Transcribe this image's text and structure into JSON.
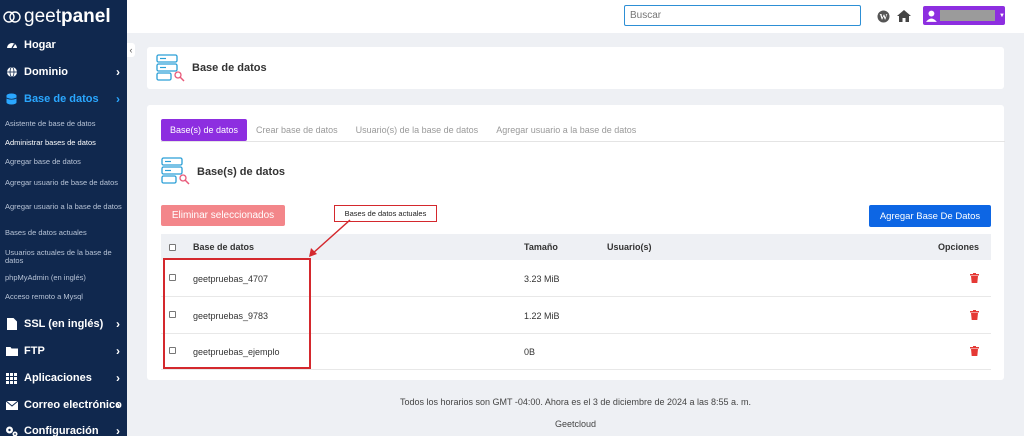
{
  "brand": {
    "prefix": "geet",
    "suffix": "panel"
  },
  "sidebar": {
    "items": [
      {
        "label": "Hogar",
        "icon": "dashboard-icon"
      },
      {
        "label": "Dominio",
        "icon": "globe-icon"
      },
      {
        "label": "Base de datos",
        "icon": "database-icon"
      },
      {
        "label": "SSL (en inglés)",
        "icon": "file-icon"
      },
      {
        "label": "FTP",
        "icon": "folder-icon"
      },
      {
        "label": "Aplicaciones",
        "icon": "grid-icon"
      },
      {
        "label": "Correo electrónico",
        "icon": "envelope-icon"
      },
      {
        "label": "Configuración",
        "icon": "gears-icon"
      }
    ],
    "subitems": [
      "Asistente de base de datos",
      "Administrar bases de datos",
      "Agregar base de datos",
      "Agregar usuario de base de datos",
      "Agregar usuario a la base de datos",
      "Bases de datos actuales",
      "Usuarios actuales de la base de datos",
      "phpMyAdmin (en inglés)",
      "Acceso remoto a Mysql"
    ]
  },
  "topbar": {
    "search_placeholder": "Buscar"
  },
  "header": {
    "title": "Base de datos"
  },
  "tabs": [
    "Base(s) de datos",
    "Crear base de datos",
    "Usuario(s) de la base de datos",
    "Agregar usuario a la base de datos"
  ],
  "section": {
    "title": "Base(s) de datos"
  },
  "buttons": {
    "delete": "Eliminar seleccionados",
    "add": "Agregar Base De Datos"
  },
  "table": {
    "headers": {
      "name": "Base de datos",
      "size": "Tamaño",
      "users": "Usuario(s)",
      "options": "Opciones"
    },
    "rows": [
      {
        "name": "geetpruebas_4707",
        "size": "3.23 MiB"
      },
      {
        "name": "geetpruebas_9783",
        "size": "1.22 MiB"
      },
      {
        "name": "geetpruebas_ejemplo",
        "size": "0B"
      }
    ]
  },
  "annotation": {
    "label": "Bases de datos actuales"
  },
  "footer": {
    "time": "Todos los horarios son GMT -04:00. Ahora es el 3 de diciembre de 2024 a las 8:55 a. m.",
    "company": "Geetcloud"
  },
  "colors": {
    "sidebar": "#10284e",
    "accent": "#8d2ee0",
    "primary": "#0d66e4",
    "danger": "#d4282d"
  }
}
